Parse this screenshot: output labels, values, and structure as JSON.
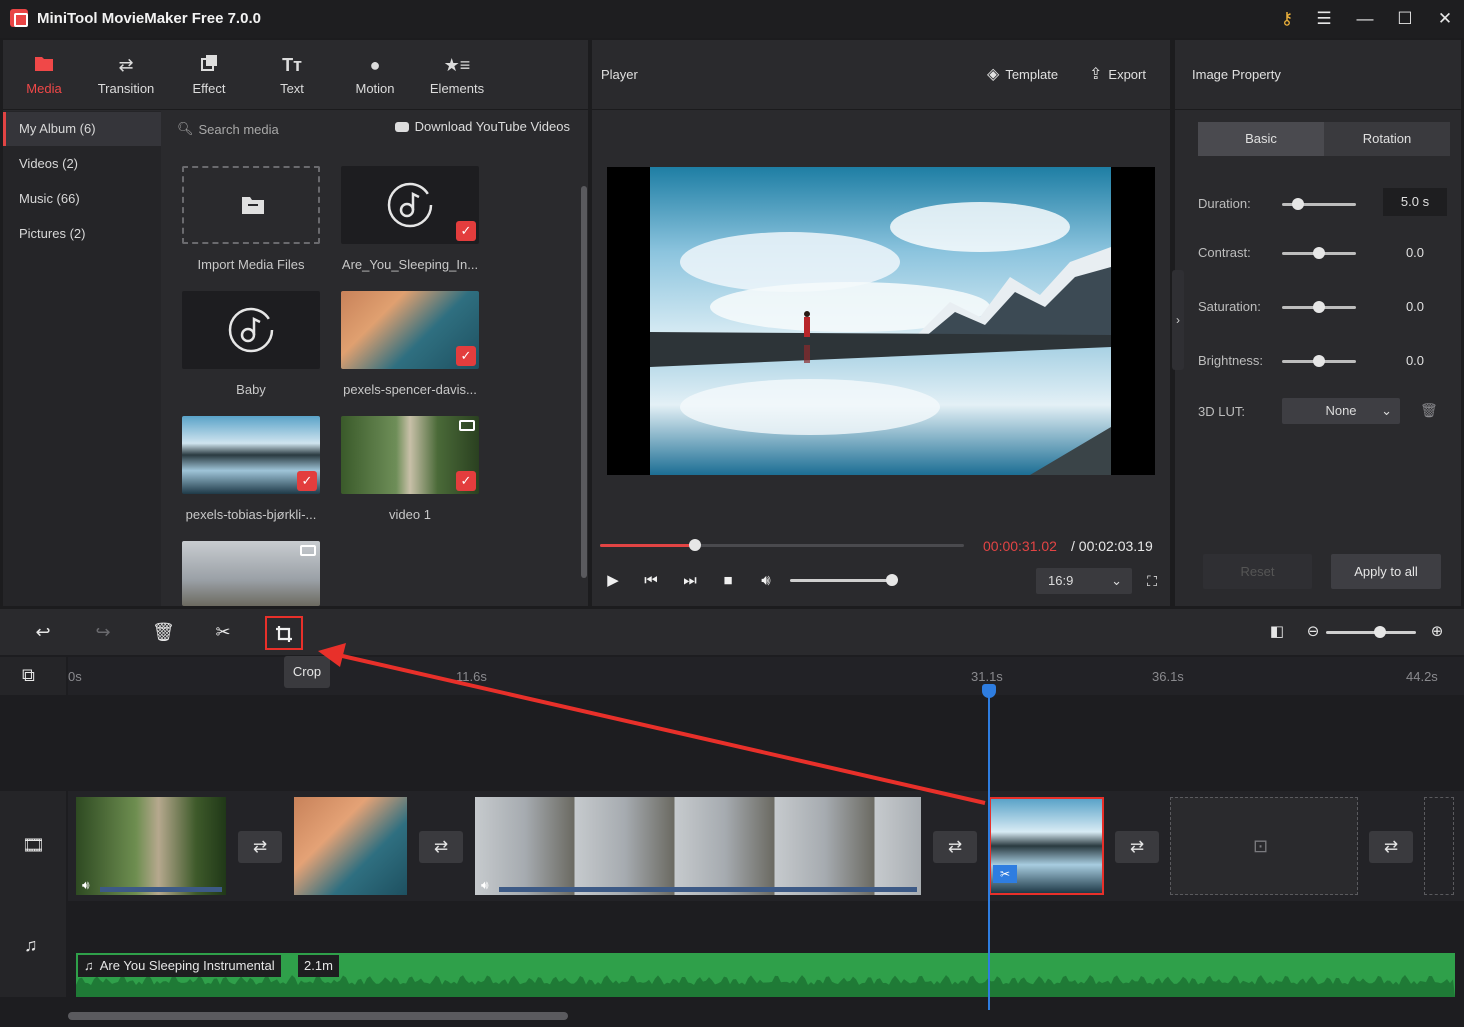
{
  "app": {
    "title": "MiniTool MovieMaker Free 7.0.0",
    "accent": "#e24444"
  },
  "tabs": [
    {
      "label": "Media",
      "icon": "folder-icon"
    },
    {
      "label": "Transition",
      "icon": "swap-icon"
    },
    {
      "label": "Effect",
      "icon": "effect-icon"
    },
    {
      "label": "Text",
      "icon": "text-icon"
    },
    {
      "label": "Motion",
      "icon": "motion-icon"
    },
    {
      "label": "Elements",
      "icon": "elements-icon"
    }
  ],
  "albums": [
    "My Album (6)",
    "Videos (2)",
    "Music (66)",
    "Pictures (2)"
  ],
  "media": {
    "search_placeholder": "Search media",
    "download_label": "Download YouTube Videos",
    "items": [
      "Import Media Files",
      "Are_You_Sleeping_In...",
      "Baby",
      "pexels-spencer-davis...",
      "pexels-tobias-bjørkli-...",
      "video 1"
    ]
  },
  "player": {
    "title": "Player",
    "template_label": "Template",
    "export_label": "Export",
    "current_time": "00:00:31.02",
    "total_time": "/ 00:02:03.19",
    "progress": 0.26,
    "volume": 0.98,
    "aspect_ratio": "16:9"
  },
  "property": {
    "title": "Image Property",
    "tabs": [
      "Basic",
      "Rotation"
    ],
    "rows": [
      {
        "label": "Duration:",
        "value": "5.0 s",
        "level": 0.22
      },
      {
        "label": "Contrast:",
        "value": "0.0",
        "level": 0.5
      },
      {
        "label": "Saturation:",
        "value": "0.0",
        "level": 0.5
      },
      {
        "label": "Brightness:",
        "value": "0.0",
        "level": 0.5
      }
    ],
    "lut_label": "3D LUT:",
    "lut_value": "None",
    "reset_label": "Reset",
    "apply_label": "Apply to all"
  },
  "timeline": {
    "tooltip": "Crop",
    "ticks": [
      "0s",
      "11.6s",
      "31.1s",
      "36.1s",
      "44.2s"
    ],
    "zoom": 0.6,
    "audio_name": "Are You Sleeping Instrumental",
    "audio_duration": "2.1m"
  }
}
